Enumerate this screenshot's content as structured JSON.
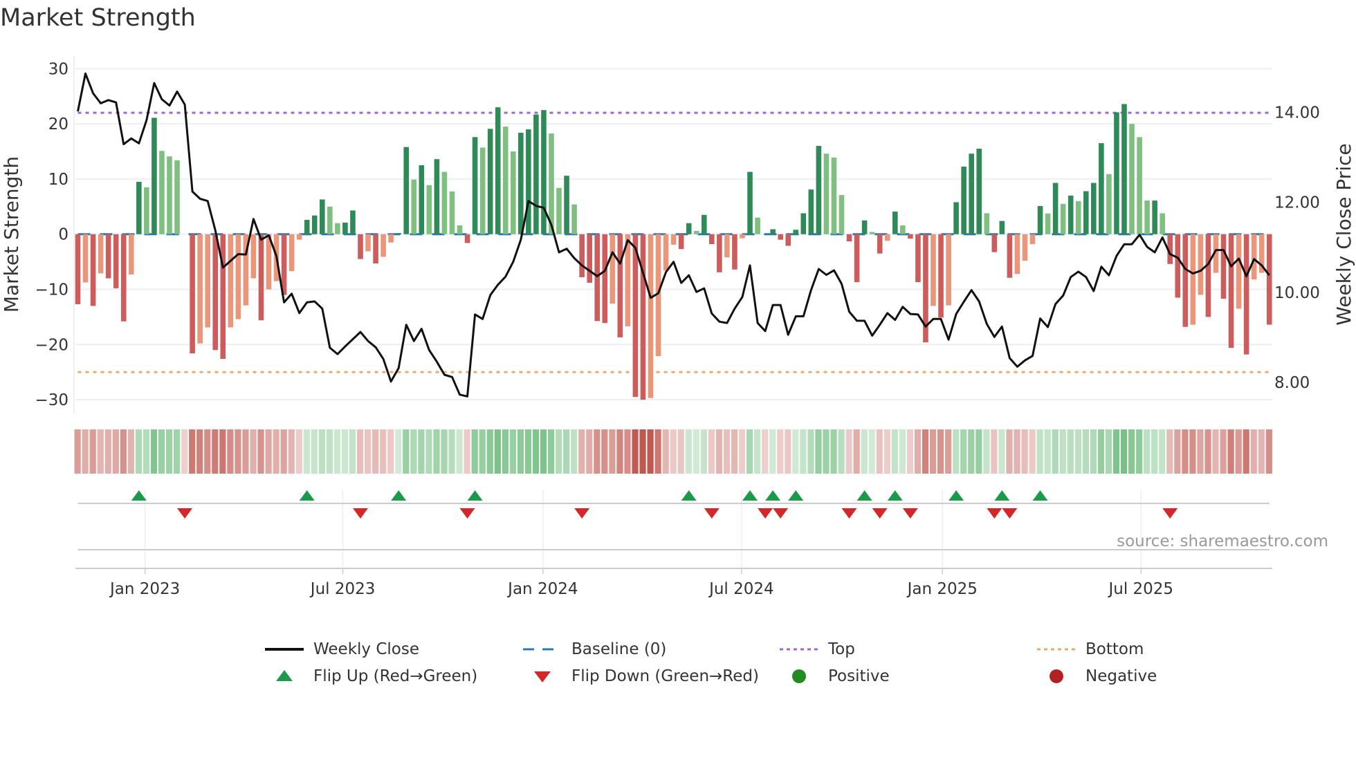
{
  "title": "Market Strength",
  "source": "source: sharemaestro.com",
  "legend": {
    "weekly_close": "Weekly Close",
    "baseline": "Baseline (0)",
    "top": "Top",
    "bottom": "Bottom",
    "flip_up": "Flip Up (Red→Green)",
    "flip_down": "Flip Down (Green→Red)",
    "positive": "Positive",
    "negative": "Negative"
  },
  "colors": {
    "strong_up": "#2e8b57",
    "weak_up": "#7fbf7f",
    "strong_down": "#cd5c5c",
    "weak_down": "#e9967a",
    "close": "#111111",
    "baseline": "#2b78b0",
    "top": "#a064dc",
    "bottom": "#f0a868",
    "flip_up": "#1a9a4a",
    "flip_down": "#d62728",
    "positive": "#228b22",
    "negative": "#b22222"
  },
  "chart_data": {
    "type": "bar",
    "title": "Market Strength",
    "ylabel": "Market Strength",
    "ylabel_right": "Weekly Close Price",
    "ylim": [
      -32.5,
      32.3
    ],
    "ylim_right": [
      7.31,
      15.25
    ],
    "top_level": 22,
    "bottom_level": -25,
    "baseline": 0,
    "y_ticks": [
      {
        "value": 30,
        "label": "30"
      },
      {
        "value": 20,
        "label": "20"
      },
      {
        "value": 10,
        "label": "10"
      },
      {
        "value": 0,
        "label": "0"
      },
      {
        "value": -10,
        "label": "−10"
      },
      {
        "value": -20,
        "label": "−20"
      },
      {
        "value": -30,
        "label": "−30"
      }
    ],
    "y_right_ticks": [
      {
        "value": 14,
        "label": "14.00"
      },
      {
        "value": 12,
        "label": "12.00"
      },
      {
        "value": 10,
        "label": "10.00"
      },
      {
        "value": 8,
        "label": "8.00"
      }
    ],
    "x_ticks": [
      {
        "week": 8.8,
        "label": "Jan 2023"
      },
      {
        "week": 34.7,
        "label": "Jul 2023"
      },
      {
        "week": 60.9,
        "label": "Jan 2024"
      },
      {
        "week": 86.9,
        "label": "Jul 2024"
      },
      {
        "week": 113.2,
        "label": "Jan 2025"
      },
      {
        "week": 139.2,
        "label": "Jul 2025"
      }
    ],
    "strength": [
      -12.7,
      -8.75,
      -13,
      -7.1,
      -8,
      -9.8,
      -15.8,
      -7.3,
      9.5,
      8.5,
      21.1,
      15.1,
      14.1,
      13.4,
      0,
      -21.6,
      -19.8,
      -16.9,
      -21,
      -22.6,
      -16.9,
      -15.4,
      -12.9,
      -8,
      -15.6,
      -10,
      -8.5,
      -11,
      -6.7,
      -1,
      2.6,
      3.4,
      6.3,
      5,
      2,
      2.1,
      4.3,
      -4.5,
      -3.1,
      -5.3,
      -4.1,
      -1.5,
      0.2,
      15.8,
      9.9,
      12.5,
      8.9,
      13.6,
      11.3,
      7.75,
      1.6,
      -1.6,
      17.6,
      15.7,
      19.1,
      23,
      19.5,
      15,
      18.4,
      19,
      21.7,
      22.5,
      18.25,
      8.4,
      10.6,
      5.4,
      -7.8,
      -8.8,
      -15.75,
      -16.1,
      -12.6,
      -18.7,
      -16.7,
      -29.5,
      -30,
      -29.7,
      -22.1,
      -6.6,
      -1.9,
      -2.7,
      2,
      0.6,
      3.5,
      -1.8,
      -6.9,
      -4.2,
      -6.4,
      -0.75,
      11.3,
      3,
      0,
      0.9,
      -1,
      -2.1,
      0.8,
      3.8,
      8.1,
      16,
      14.6,
      13.9,
      7.1,
      -1.3,
      -8.7,
      2.5,
      0.4,
      -3.5,
      -1.2,
      4.1,
      1.6,
      -0.8,
      -8.7,
      -19.6,
      -13,
      -15.1,
      -12.9,
      5.8,
      12.25,
      14.6,
      15.5,
      3.8,
      -3.25,
      2.4,
      -7.9,
      -7.2,
      -4.8,
      -1.8,
      5.1,
      3.75,
      9.3,
      5.5,
      7,
      6,
      7.8,
      9.3,
      16.5,
      10.9,
      22.1,
      23.6,
      20,
      17.6,
      6.1,
      6.1,
      3.8,
      -5.4,
      -11.5,
      -16.8,
      -16.4,
      -11,
      -15,
      -7,
      -11.7,
      -20.6,
      -13.5,
      -21.8,
      -8.2,
      -7,
      -16.4
    ],
    "weekly_close": [
      14.02,
      14.86,
      14.42,
      14.2,
      14.27,
      14.22,
      13.29,
      13.42,
      13.31,
      13.83,
      14.65,
      14.29,
      14.15,
      14.46,
      14.17,
      12.24,
      12.08,
      12.03,
      11.38,
      10.55,
      10.7,
      10.85,
      10.84,
      11.63,
      11.17,
      11.27,
      10.81,
      9.78,
      9.97,
      9.54,
      9.78,
      9.8,
      9.64,
      8.77,
      8.63,
      8.8,
      8.96,
      9.12,
      8.92,
      8.78,
      8.52,
      8.02,
      8.32,
      9.28,
      8.92,
      9.19,
      8.72,
      8.46,
      8.17,
      8.12,
      7.73,
      7.69,
      9.51,
      9.41,
      9.94,
      10.17,
      10.35,
      10.68,
      11.17,
      12.03,
      11.92,
      11.88,
      11.5,
      10.89,
      10.97,
      10.76,
      10.6,
      10.48,
      10.36,
      10.48,
      10.89,
      10.64,
      11.16,
      10.99,
      10.43,
      9.88,
      9.98,
      10.45,
      10.68,
      10.21,
      10.38,
      10.01,
      10.09,
      9.53,
      9.35,
      9.32,
      9.64,
      9.9,
      10.6,
      9.32,
      9.14,
      9.72,
      9.72,
      9.06,
      9.47,
      9.47,
      10.05,
      10.52,
      10.39,
      10.49,
      10.19,
      9.57,
      9.37,
      9.37,
      9.04,
      9.28,
      9.54,
      9.39,
      9.68,
      9.52,
      9.51,
      9.24,
      9.41,
      9.41,
      8.95,
      9.52,
      9.79,
      10.05,
      9.8,
      9.3,
      9.01,
      9.24,
      8.54,
      8.35,
      8.49,
      8.59,
      9.42,
      9.23,
      9.74,
      9.93,
      10.34,
      10.46,
      10.34,
      10.03,
      10.57,
      10.38,
      10.81,
      11.07,
      11.07,
      11.28,
      11.01,
      10.89,
      11.22,
      10.85,
      10.77,
      10.52,
      10.42,
      10.48,
      10.63,
      10.94,
      10.94,
      10.58,
      10.75,
      10.36,
      10.74,
      10.6,
      10.38
    ]
  }
}
